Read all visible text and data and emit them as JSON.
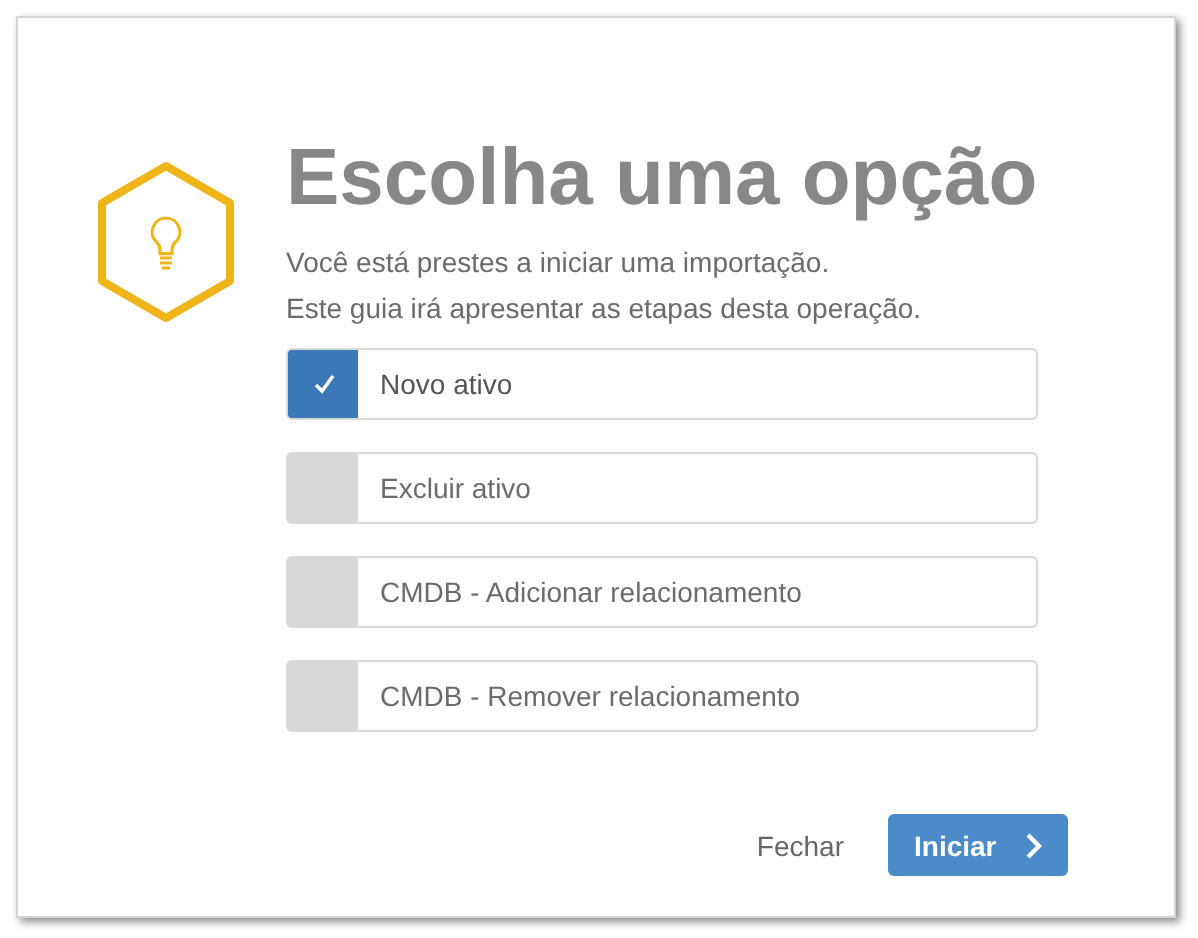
{
  "dialog": {
    "title": "Escolha uma opção",
    "description": [
      "Você está prestes a iniciar uma importação.",
      "Este guia irá apresentar as etapas desta operação."
    ],
    "options": [
      {
        "label": "Novo ativo",
        "selected": true
      },
      {
        "label": "Excluir ativo",
        "selected": false
      },
      {
        "label": "CMDB - Adicionar relacionamento",
        "selected": false
      },
      {
        "label": "CMDB - Remover relacionamento",
        "selected": false
      }
    ],
    "buttons": [
      {
        "label": "Fechar",
        "kind": "link"
      },
      {
        "label": "Iniciar",
        "kind": "primary"
      }
    ]
  }
}
